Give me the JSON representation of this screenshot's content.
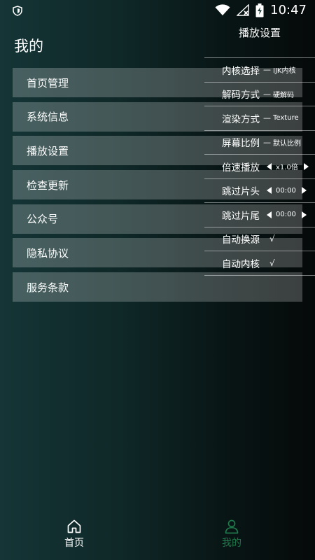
{
  "status_bar": {
    "time": "10:47"
  },
  "page": {
    "title": "我的"
  },
  "menu": {
    "items": [
      {
        "label": "首页管理"
      },
      {
        "label": "系统信息"
      },
      {
        "label": "播放设置"
      },
      {
        "label": "检查更新"
      },
      {
        "label": "公众号"
      },
      {
        "label": "隐私协议"
      },
      {
        "label": "服务条款"
      }
    ]
  },
  "play_settings": {
    "title": "播放设置",
    "rows": [
      {
        "label": "内核选择",
        "separator": "—",
        "value": "IJK内核"
      },
      {
        "label": "解码方式",
        "separator": "—",
        "value": "硬解码"
      },
      {
        "label": "渲染方式",
        "separator": "—",
        "value": "Texture"
      },
      {
        "label": "屏幕比例",
        "separator": "—",
        "value": "默认比例"
      },
      {
        "label": "倍速播放",
        "value": "x1.0倍"
      },
      {
        "label": "跳过片头",
        "value": "00:00"
      },
      {
        "label": "跳过片尾",
        "value": "00:00"
      },
      {
        "label": "自动换源",
        "check": "√"
      },
      {
        "label": "自动内核",
        "check": "√"
      }
    ]
  },
  "bottom_nav": {
    "items": [
      {
        "label": "首页",
        "icon": "home-icon",
        "color": "#ffffff"
      },
      {
        "label": "我的",
        "icon": "user-icon",
        "color": "#1f7a4c"
      }
    ]
  }
}
